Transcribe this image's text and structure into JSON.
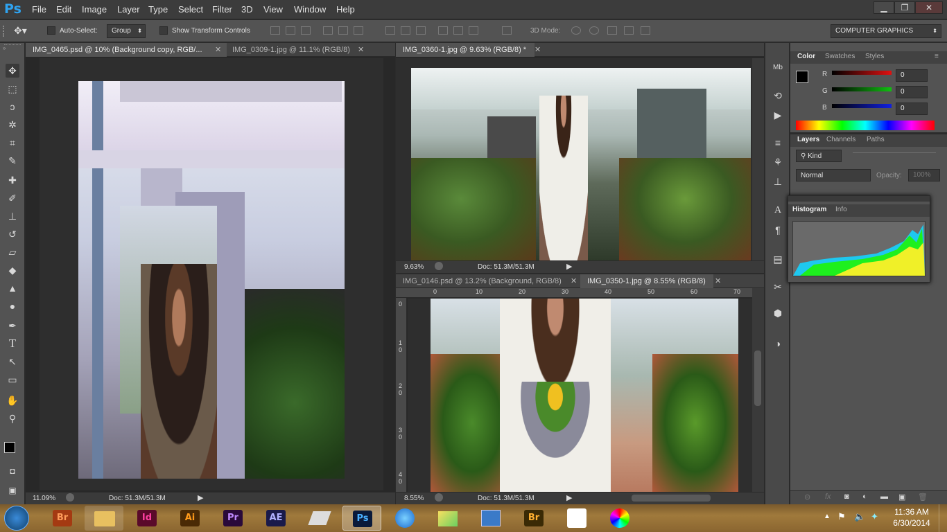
{
  "app": {
    "logo": "Ps"
  },
  "menu": [
    "File",
    "Edit",
    "Image",
    "Layer",
    "Type",
    "Select",
    "Filter",
    "3D",
    "View",
    "Window",
    "Help"
  ],
  "window_controls": {
    "minimize": "▁",
    "restore": "❐",
    "close": "✕"
  },
  "options": {
    "auto_select_label": "Auto-Select:",
    "auto_select_value": "Group",
    "show_transform_label": "Show Transform Controls",
    "mode_label": "3D Mode:",
    "workspace": "COMPUTER GRAPHICS"
  },
  "documents": {
    "left": {
      "tabs": [
        {
          "label": "IMG_0465.psd @ 10% (Background copy, RGB/...",
          "active": true
        },
        {
          "label": "IMG_0309-1.jpg @ 11.1% (RGB/8)",
          "active": false
        }
      ],
      "zoom": "11.09%",
      "doc_size": "Doc: 51.3M/51.3M"
    },
    "top_right": {
      "tabs": [
        {
          "label": "IMG_0360-1.jpg @ 9.63% (RGB/8) *",
          "active": true
        }
      ],
      "zoom": "9.63%",
      "doc_size": "Doc: 51.3M/51.3M"
    },
    "bottom_right": {
      "tabs": [
        {
          "label": "IMG_0146.psd @ 13.2% (Background, RGB/8)",
          "active": false
        },
        {
          "label": "IMG_0350-1.jpg @ 8.55% (RGB/8)",
          "active": true
        }
      ],
      "ruler_h": [
        "0",
        "10",
        "20",
        "30",
        "40",
        "50",
        "60",
        "70"
      ],
      "ruler_v": [
        "0",
        "1 0",
        "2 0",
        "3 0",
        "4 0"
      ],
      "zoom": "8.55%",
      "doc_size": "Doc: 51.3M/51.3M"
    }
  },
  "panels": {
    "color": {
      "tabs": [
        "Color",
        "Swatches",
        "Styles"
      ],
      "channels": [
        {
          "label": "R",
          "value": "0",
          "color": "#e01010"
        },
        {
          "label": "G",
          "value": "0",
          "color": "#10c010"
        },
        {
          "label": "B",
          "value": "0",
          "color": "#1020e0"
        }
      ]
    },
    "layers": {
      "tabs": [
        "Layers",
        "Channels",
        "Paths"
      ],
      "kind_label": "Kind",
      "blend_mode": "Normal",
      "opacity_label": "Opacity:",
      "opacity_value": "100%"
    },
    "histogram": {
      "tabs": [
        "Histogram",
        "Info"
      ]
    }
  },
  "taskbar": {
    "apps": [
      {
        "name": "Br",
        "bg": "#a43a12",
        "fg": "#ff9c5a"
      },
      {
        "name": "Id",
        "bg": "#5a0a2a",
        "fg": "#ff3fa0"
      },
      {
        "name": "Ai",
        "bg": "#4a2a05",
        "fg": "#ff9a1a"
      },
      {
        "name": "Pr",
        "bg": "#2a0a3a",
        "fg": "#c08aff"
      },
      {
        "name": "AE",
        "bg": "#1a1a4a",
        "fg": "#b0b0ff"
      },
      {
        "name": "Ps",
        "bg": "#0a1a3a",
        "fg": "#4ab0ff"
      },
      {
        "name": "Br",
        "bg": "#3a2a05",
        "fg": "#ffb030"
      }
    ],
    "clock_time": "11:36 AM",
    "clock_date": "6/30/2014"
  }
}
